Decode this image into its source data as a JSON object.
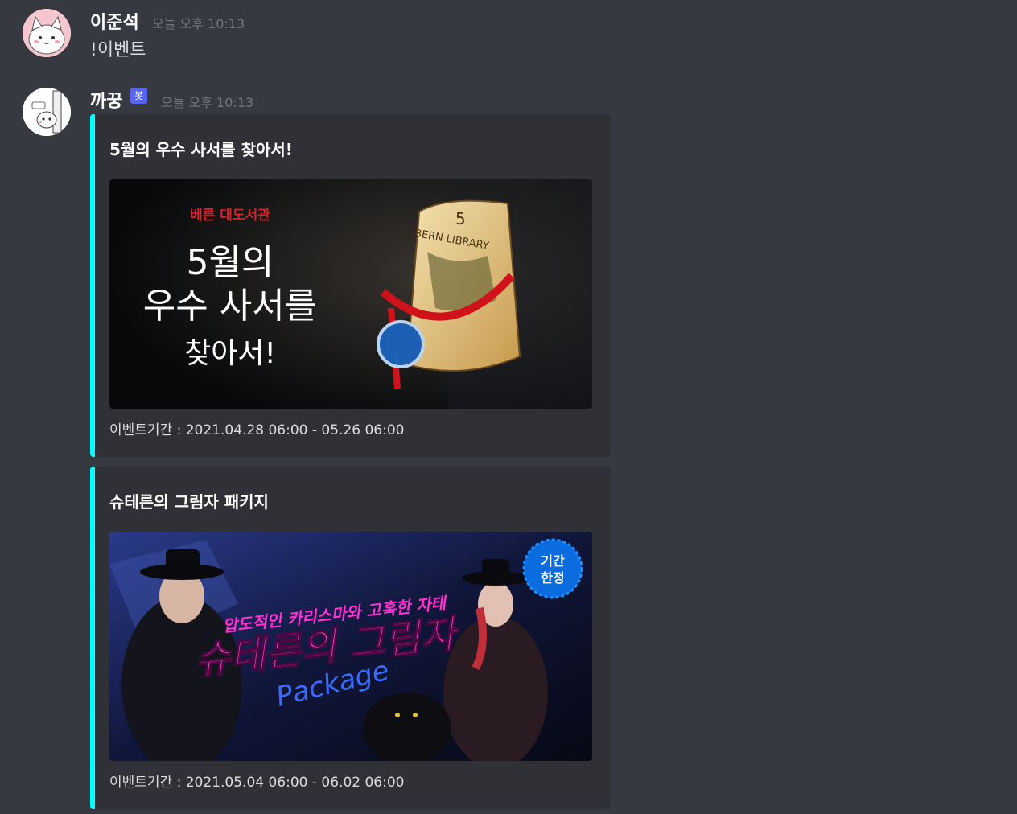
{
  "messages": [
    {
      "author": "이준석",
      "timestamp": "오늘 오후 10:13",
      "content": "!이벤트"
    },
    {
      "author": "까꿍",
      "bot_tag": "봇",
      "timestamp": "오늘 오후 10:13",
      "embeds": [
        {
          "title": "5월의 우수 사서를 찾아서!",
          "image_text": {
            "library": "베른 대도서관",
            "line1": "5월의",
            "line2": "우수 사서를",
            "line3": "찾아서!",
            "scroll_number": "5",
            "scroll_label": "BERN LIBRARY"
          },
          "footer": "이벤트기간 : 2021.04.28 06:00 - 05.26 06:00"
        },
        {
          "title": "슈테른의 그림자 패키지",
          "image_text": {
            "subtitle": "압도적인 카리스마와 고혹한 자태",
            "main": "슈테른의 그림자",
            "script": "Package",
            "badge_line1": "기간",
            "badge_line2": "한정"
          },
          "footer": "이벤트기간 : 2021.05.04 06:00 - 06.02 06:00"
        }
      ]
    }
  ],
  "colors": {
    "background": "#36393f",
    "embed_background": "#2f3136",
    "embed_accent": "#00ffff",
    "bot_tag": "#5865f2",
    "timestamp": "#72767d",
    "text": "#dcddde"
  }
}
